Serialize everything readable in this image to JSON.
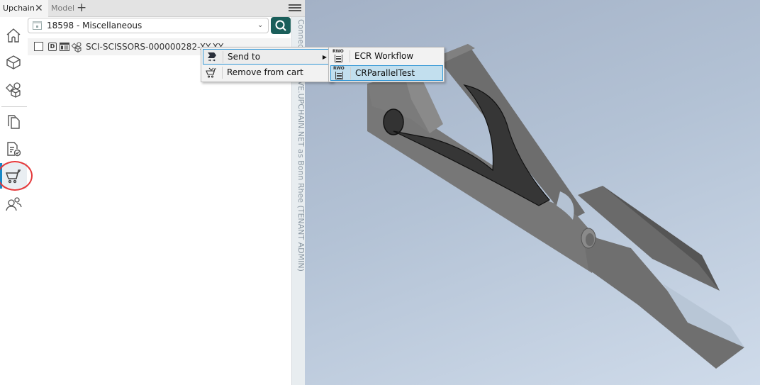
{
  "tabs": {
    "items": [
      {
        "label": "Upchain",
        "active": true,
        "close_icon": "close-icon"
      },
      {
        "label": "Model",
        "active": false
      }
    ],
    "add_icon": "plus-icon",
    "menu_icon": "hamburger-menu-icon"
  },
  "sidebar": {
    "items": [
      {
        "name": "home",
        "icon": "home-icon"
      },
      {
        "name": "part",
        "icon": "cube-icon"
      },
      {
        "name": "assembly",
        "icon": "assembly-icon"
      },
      {
        "name": "documents",
        "icon": "documents-icon"
      },
      {
        "name": "approvals",
        "icon": "document-check-icon"
      },
      {
        "name": "cart",
        "icon": "cart-icon",
        "active": true,
        "annotated": true
      },
      {
        "name": "users",
        "icon": "users-icon"
      }
    ],
    "active_color": "#1788c7",
    "annotation_color": "#e4383a"
  },
  "project_selector": {
    "icon": "calendar-icon",
    "value": "18598 - Miscellaneous",
    "chevron_icon": "chevron-down-icon"
  },
  "search_button": {
    "icon": "search-icon",
    "color": "#1a5e5a"
  },
  "tree": {
    "rows": [
      {
        "checked": false,
        "badge": "D",
        "icons": [
          "document-icon",
          "assembly-icon"
        ],
        "name": "SCI-SCISSORS-000000282-XY-XY"
      }
    ]
  },
  "connection_status": "Connected to LIVE.UPCHAIN.NET as Bonn Rhee (TENANT ADMIN)",
  "context_menu": {
    "items": [
      {
        "label": "Send to",
        "icon": "send-to-icon",
        "has_submenu": true,
        "hovered": true
      },
      {
        "label": "Remove from cart",
        "icon": "remove-cart-icon",
        "has_submenu": false
      }
    ],
    "submenu": {
      "badge_text": "RWO",
      "items": [
        {
          "label": "ECR Workflow",
          "icon": "workflow-icon",
          "selected": false
        },
        {
          "label": "CRParallelTest",
          "icon": "workflow-icon",
          "selected": true
        }
      ]
    }
  },
  "viewport": {
    "model": "scissors-3d-model",
    "background_top": "#a3b1c6",
    "background_bottom": "#cfdbea"
  }
}
